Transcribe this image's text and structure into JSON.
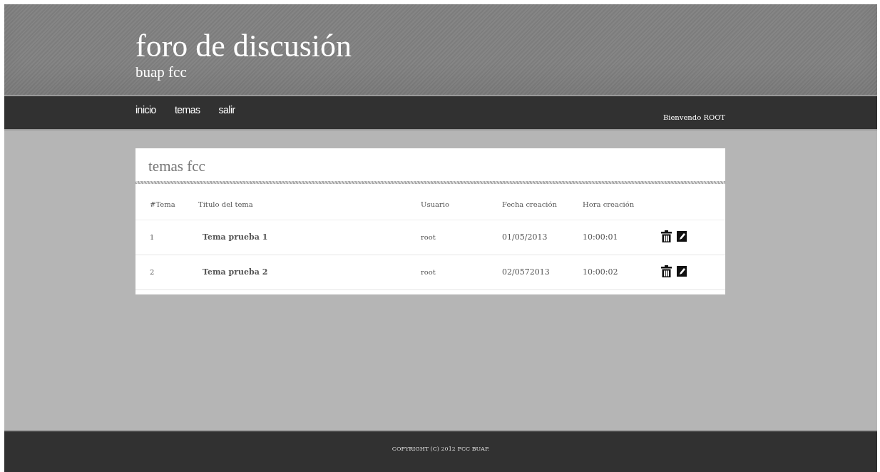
{
  "header": {
    "title": "foro de discusión",
    "subtitle": "buap fcc"
  },
  "nav": {
    "links": [
      "inicio",
      "temas",
      "salir"
    ],
    "welcome": "Bienvendo ROOT"
  },
  "panel": {
    "title": "temas fcc",
    "columns": [
      "#Tema",
      "Titulo del tema",
      "Usuario",
      "Fecha creación",
      "Hora creación"
    ],
    "rows": [
      {
        "number": "1",
        "title": "Tema prueba 1",
        "user": "root",
        "date": "01/05/2013",
        "time": "10:00:01"
      },
      {
        "number": "2",
        "title": "Tema prueba 2",
        "user": "root",
        "date": "02/0572013",
        "time": "10:00:02"
      }
    ]
  },
  "footer": "COPYRIGHT (C) 2012 FCC BUAP."
}
